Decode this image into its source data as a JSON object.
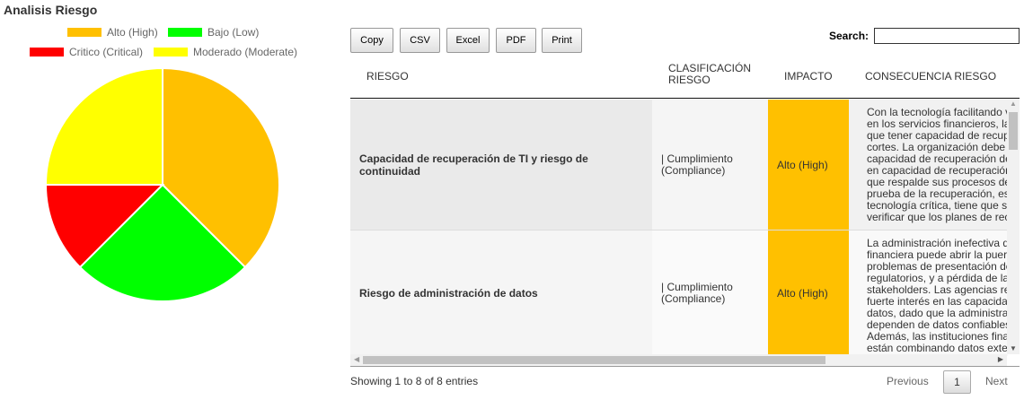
{
  "chart_data": {
    "type": "pie",
    "title": "Analisis Riesgo",
    "legend_placement": "top",
    "slices": [
      {
        "name": "Alto (High)",
        "value": 3,
        "color": "#FFC000"
      },
      {
        "name": "Bajo (Low)",
        "value": 2,
        "color": "#00FF00"
      },
      {
        "name": "Critico (Critical)",
        "value": 1,
        "color": "#FF0000"
      },
      {
        "name": "Moderado (Moderate)",
        "value": 2,
        "color": "#FFFF00"
      }
    ]
  },
  "toolbar": {
    "buttons": [
      "Copy",
      "CSV",
      "Excel",
      "PDF",
      "Print"
    ],
    "search_label": "Search:",
    "search_value": ""
  },
  "table": {
    "headers": [
      "RIESGO",
      "CLASIFICACIÓN RIESGO",
      "IMPACTO",
      "CONSECUENCIA RIESGO"
    ],
    "rows": [
      {
        "riesgo": "Capacidad de recuperación de TI y riesgo de continuidad",
        "clasificacion": "| Cumplimiento (Compliance)",
        "impacto": "Alto (High)",
        "impacto_color": "#FFC000",
        "consecuencia": [
          "Con la tecnología facilitando vir",
          "en los servicios financieros, la T",
          "que tener capacidad de recupe",
          "cortes. La organización debe te",
          "capacidad de recuperación de",
          "en capacidad de recuperación",
          "que respalde sus procesos de",
          "prueba de la recuperación, esp",
          "tecnología crítica, tiene que ser",
          "verificar que los planes de recu"
        ]
      },
      {
        "riesgo": "Riesgo de administración de datos",
        "clasificacion": "| Cumplimiento (Compliance)",
        "impacto": "Alto (High)",
        "impacto_color": "#FFC000",
        "consecuencia": [
          "La administración inefectiva de",
          "financiera puede abrir la puerta",
          "problemas de presentación de",
          "regulatorios, y a pérdida de la c",
          "stakeholders. Las agencias reg",
          "fuerte interés en las capacidade",
          "datos, dado que la administraci",
          "dependen de datos confiables,",
          "Además, las instituciones finan",
          "están combinando datos exterr"
        ]
      }
    ]
  },
  "footer": {
    "info": "Showing 1 to 8 of 8 entries",
    "previous": "Previous",
    "page": "1",
    "next": "Next"
  }
}
